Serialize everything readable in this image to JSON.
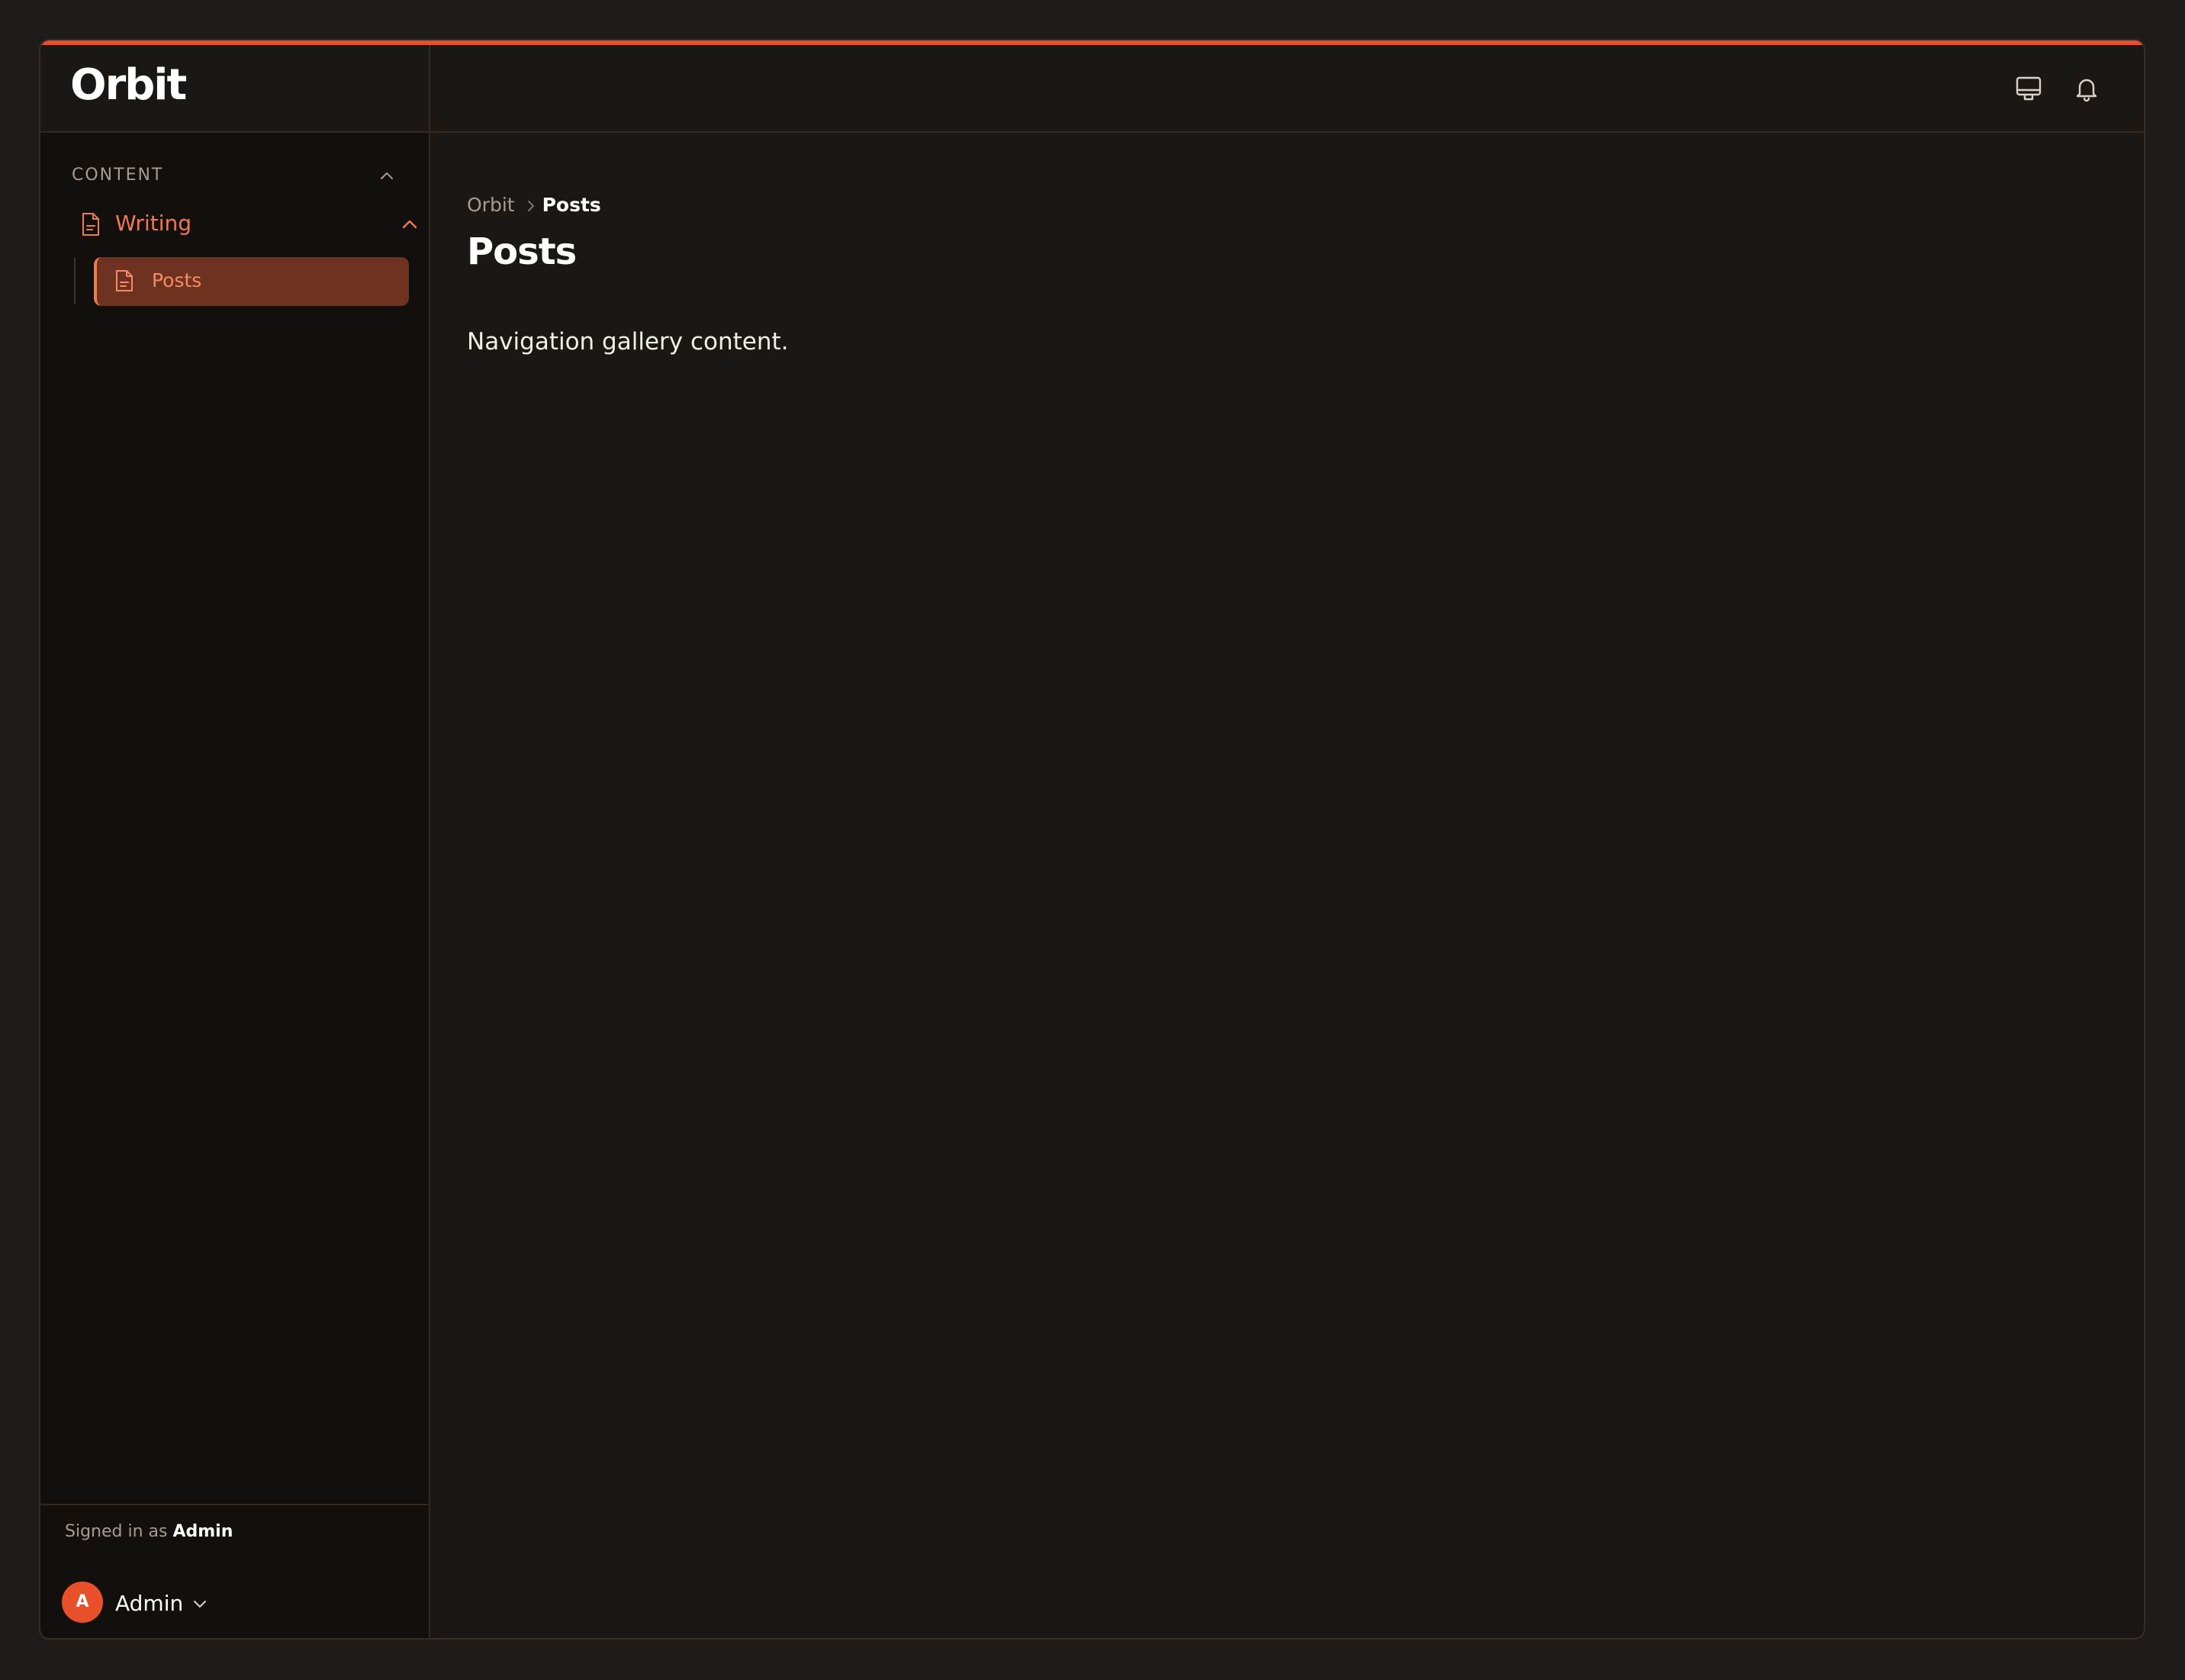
{
  "app": {
    "brand": "Orbit",
    "accent_color": "#e8502a"
  },
  "topbar": {
    "icons": [
      {
        "name": "monitor-icon"
      },
      {
        "name": "bell-icon"
      }
    ]
  },
  "sidebar": {
    "section": {
      "label": "CONTENT",
      "expanded": true
    },
    "group": {
      "label": "Writing",
      "icon": "document-icon",
      "expanded": true
    },
    "items": [
      {
        "label": "Posts",
        "icon": "document-icon",
        "active": true
      }
    ],
    "footer": {
      "signed_in_prefix": "Signed in as",
      "signed_in_user": "Admin",
      "avatar_initial": "A",
      "user_name": "Admin"
    }
  },
  "main": {
    "breadcrumb": {
      "root": "Orbit",
      "current": "Posts"
    },
    "title": "Posts",
    "body": "Navigation gallery content."
  }
}
